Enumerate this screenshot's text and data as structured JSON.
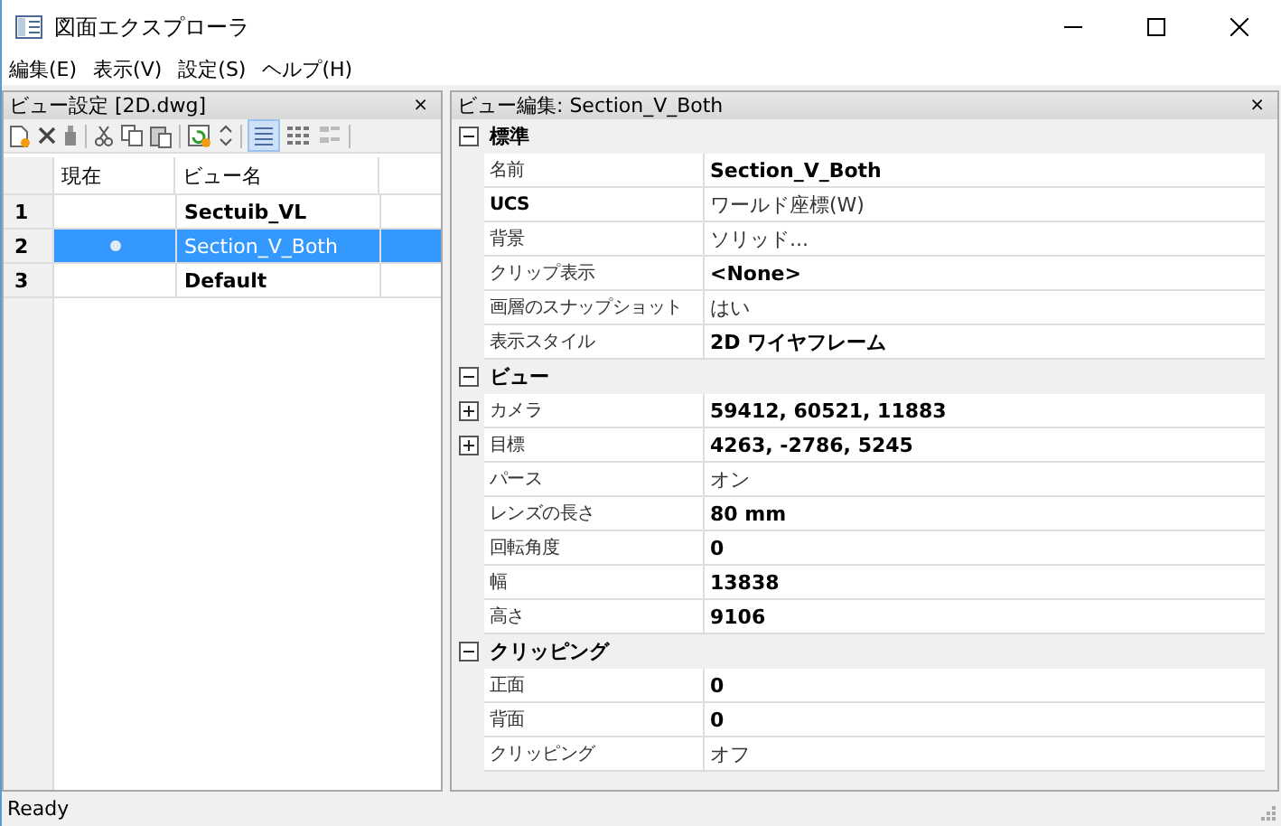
{
  "window": {
    "title": "図面エクスプローラ"
  },
  "menu": [
    "編集(E)",
    "表示(V)",
    "設定(S)",
    "ヘルプ(H)"
  ],
  "left_panel": {
    "title": "ビュー設定 [2D.dwg]",
    "close": "×",
    "columns": [
      "現在",
      "ビュー名"
    ],
    "rows": [
      {
        "number": "1",
        "current": false,
        "name": "Sectuib_VL",
        "selected": false
      },
      {
        "number": "2",
        "current": true,
        "name": "Section_V_Both",
        "selected": true
      },
      {
        "number": "3",
        "current": false,
        "name": "Default",
        "selected": false
      }
    ]
  },
  "right_panel": {
    "title": "ビュー編集: Section_V_Both",
    "close": "×",
    "sections": [
      {
        "title": "標準",
        "expanded": true,
        "rows": [
          {
            "label": "名前",
            "value": "Section_V_Both",
            "label_bold": false,
            "value_bold": true,
            "kind": "plain"
          },
          {
            "label": "UCS",
            "value": "ワールド座標(W)",
            "label_bold": true,
            "value_bold": false,
            "kind": "plain"
          },
          {
            "label": "背景",
            "value": "ソリッド...",
            "label_bold": false,
            "value_bold": false,
            "kind": "plain"
          },
          {
            "label": "クリップ表示",
            "value": "<None>",
            "label_bold": false,
            "value_bold": true,
            "kind": "plain"
          },
          {
            "label": "画層のスナップショット",
            "value": "はい",
            "label_bold": false,
            "value_bold": false,
            "kind": "plain"
          },
          {
            "label": "表示スタイル",
            "value": "2D ワイヤフレーム",
            "label_bold": false,
            "value_bold": true,
            "kind": "plain"
          }
        ]
      },
      {
        "title": "ビュー",
        "expanded": true,
        "rows": [
          {
            "label": "カメラ",
            "value": "59412, 60521, 11883",
            "label_bold": false,
            "value_bold": true,
            "kind": "expandable"
          },
          {
            "label": "目標",
            "value": "4263, -2786, 5245",
            "label_bold": false,
            "value_bold": true,
            "kind": "expandable"
          },
          {
            "label": "パース",
            "value": "オン",
            "label_bold": false,
            "value_bold": false,
            "kind": "plain"
          },
          {
            "label": "レンズの長さ",
            "value": "80 mm",
            "label_bold": false,
            "value_bold": true,
            "kind": "plain"
          },
          {
            "label": "回転角度",
            "value": "0",
            "label_bold": false,
            "value_bold": true,
            "kind": "plain"
          },
          {
            "label": "幅",
            "value": "13838",
            "label_bold": false,
            "value_bold": true,
            "kind": "plain"
          },
          {
            "label": "高さ",
            "value": "9106",
            "label_bold": false,
            "value_bold": true,
            "kind": "plain"
          }
        ]
      },
      {
        "title": "クリッピング",
        "expanded": true,
        "rows": [
          {
            "label": "正面",
            "value": "0",
            "label_bold": false,
            "value_bold": true,
            "kind": "plain"
          },
          {
            "label": "背面",
            "value": "0",
            "label_bold": false,
            "value_bold": true,
            "kind": "plain"
          },
          {
            "label": "クリッピング",
            "value": "オフ",
            "label_bold": false,
            "value_bold": false,
            "kind": "plain"
          }
        ]
      }
    ]
  },
  "status_bar": "Ready"
}
